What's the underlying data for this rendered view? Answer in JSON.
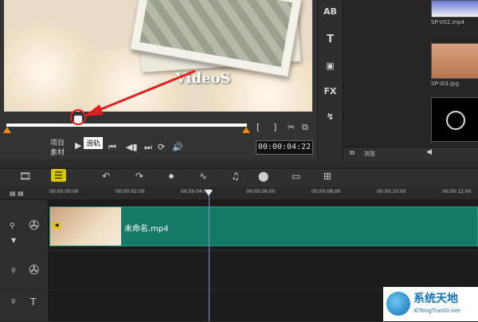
{
  "preview": {
    "video_title": "VideoS",
    "tooltip": "滑轨",
    "mode_project": "项目",
    "mode_clip": "素材",
    "timecode": "00:00:04:22",
    "mark_in": "[",
    "mark_out": "]"
  },
  "library": {
    "tools": [
      "AB",
      "T",
      "FX"
    ],
    "thumbs": [
      {
        "label": "SP-V02.mp4"
      },
      {
        "label": "SP-I03.jpg"
      }
    ],
    "browse_label": "浏览"
  },
  "timeline": {
    "ruler_ticks": [
      "00:00:00:00",
      "00:00:02:00",
      "00:00:04:00",
      "00:00:06:00",
      "00:00:08:00",
      "00:00:10:00",
      "00:00:12:00"
    ],
    "clip_name": "未命名.mp4"
  },
  "watermark": {
    "text": "系统天地",
    "url": "XiTongTianDi.net"
  },
  "colors": {
    "clip_green": "#147a66",
    "trim_orange": "#f08a16",
    "annotation_red": "#e01f1f"
  }
}
